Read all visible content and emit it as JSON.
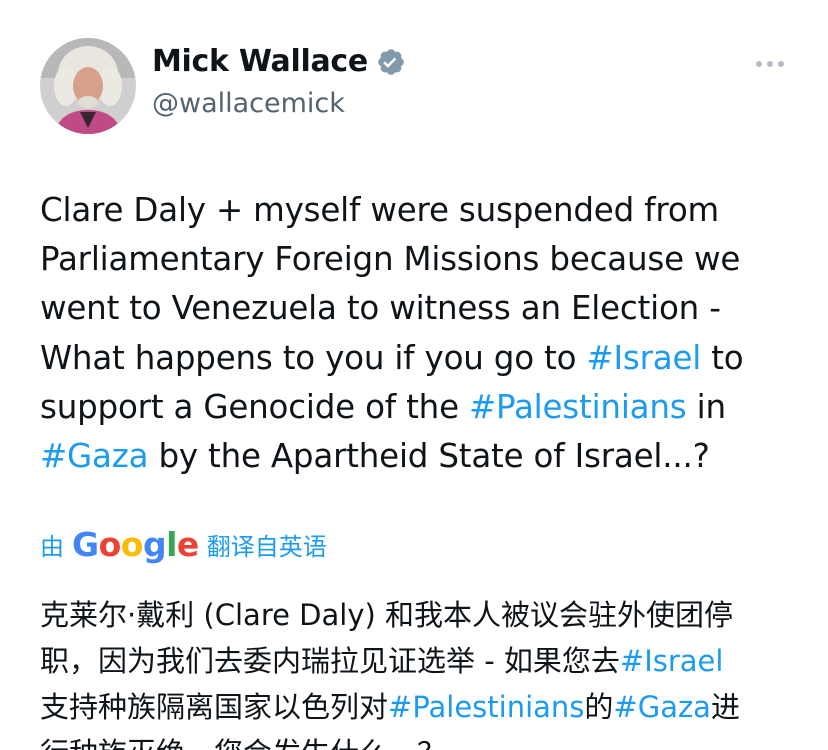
{
  "author": {
    "name": "Mick Wallace",
    "handle": "@wallacemick"
  },
  "tweet_text": {
    "line1": "Clare Daly + myself were suspended from",
    "line2": "Parliamentary Foreign Missions because we",
    "line3": "went to Venezuela to witness an Election -",
    "line4_before": "What happens to you if you go to ",
    "line4_tag": "#Israel",
    "line4_after": " to",
    "line5_before": "support a Genocide of the ",
    "line5_tag": "#Palestinians",
    "line5_after": " in",
    "line6_tag": "#Gaza",
    "line6_after": " by the Apartheid State of Israel...?"
  },
  "translate": {
    "by": "由",
    "google": "Google",
    "label": "翻译自英语"
  },
  "translation": {
    "line1": "克莱尔·戴利 (Clare Daly) 和我本人被议会驻外使团停",
    "line2_before": "职，因为我们去委内瑞拉见证选举 - 如果您去",
    "line2_tag": "#Israel",
    "line3_before": "支持种族隔离国家以色列对",
    "line3_tag1": "#Palestinians",
    "line3_mid": "的",
    "line3_tag2": "#Gaza",
    "line3_after": "进",
    "line4": "行种族灭绝，您会发生什么…？"
  },
  "icons": {
    "verified": "verified-badge-icon",
    "more": "more-options-icon"
  },
  "colors": {
    "hashtag": "#1d9bf0",
    "handle": "#536471",
    "text": "#0f1419"
  }
}
